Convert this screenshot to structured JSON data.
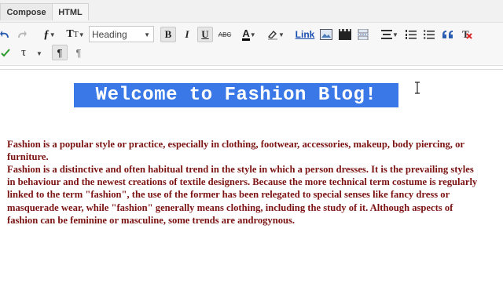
{
  "tabs": {
    "compose": "Compose",
    "html": "HTML"
  },
  "toolbar": {
    "heading_select": "Heading",
    "bold": "B",
    "italic": "I",
    "underline": "U",
    "strikethrough": "ABC",
    "text_color_letter": "A",
    "link": "Link"
  },
  "editor": {
    "title": "Welcome to Fashion Blog!",
    "paragraph1": "Fashion is a popular style or practice, especially in clothing, footwear, accessories, makeup, body piercing, or furniture.",
    "paragraph2": "Fashion is a distinctive and often habitual trend in the style in which a person dresses. It is the prevailing styles in behaviour and the newest creations of textile designers. Because the more technical term costume is regularly linked to the term \"fashion\", the use of the former has been relegated to special senses like fancy dress or masquerade wear, while \"fashion\" generally means clothing, including the study of it. Although aspects of fashion can be feminine or masculine, some trends are androgynous."
  },
  "colors": {
    "title_highlight": "#3a78e8",
    "body_text": "#7b1212",
    "link": "#1a4fb0"
  },
  "icons": [
    "undo-icon",
    "redo-icon",
    "font-family-icon",
    "font-size-icon",
    "text-color-icon",
    "highlight-icon",
    "image-icon",
    "video-icon",
    "jump-break-icon",
    "align-icon",
    "numbered-list-icon",
    "bullet-list-icon",
    "quote-icon",
    "remove-format-icon",
    "spellcheck-icon",
    "input-tools-icon",
    "ltr-icon",
    "rtl-icon",
    "cursor-icon"
  ]
}
